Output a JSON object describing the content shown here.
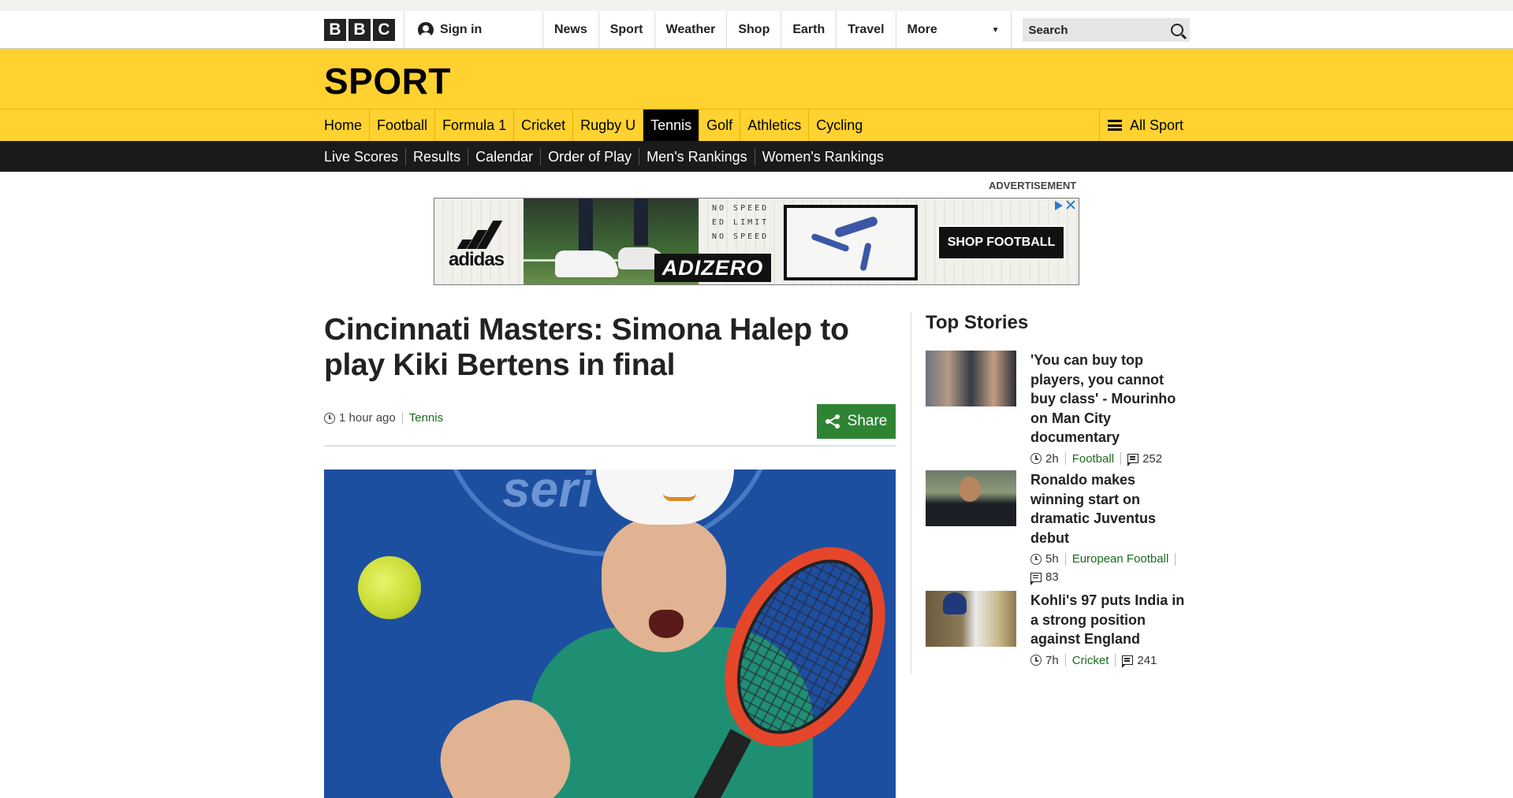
{
  "masthead": {
    "logo_letters": [
      "B",
      "B",
      "C"
    ],
    "signin": "Sign in",
    "nav": [
      "News",
      "Sport",
      "Weather",
      "Shop",
      "Earth",
      "Travel"
    ],
    "more": "More",
    "search_placeholder": "Search"
  },
  "sport": {
    "title": "SPORT",
    "nav": [
      "Home",
      "Football",
      "Formula 1",
      "Cricket",
      "Rugby U",
      "Tennis",
      "Golf",
      "Athletics",
      "Cycling"
    ],
    "active": "Tennis",
    "all_sport": "All Sport",
    "subnav": [
      "Live Scores",
      "Results",
      "Calendar",
      "Order of Play",
      "Men's Rankings",
      "Women's Rankings"
    ]
  },
  "ad": {
    "label": "ADVERTISEMENT",
    "brand": "adidas",
    "product": "ADIZERO",
    "cta": "SHOP FOOTBALL",
    "speed_text": [
      "NO SPEED",
      "ED LIMIT",
      "NO SPEED"
    ]
  },
  "article": {
    "headline": "Cincinnati Masters: Simona Halep to play Kiki Bertens in final",
    "time": "1 hour ago",
    "section": "Tennis",
    "share": "Share"
  },
  "top_stories": {
    "title": "Top Stories",
    "items": [
      {
        "title": "'You can buy top players, you cannot buy class' - Mourinho on Man City documentary",
        "time": "2h",
        "section": "Football",
        "comments": "252"
      },
      {
        "title": "Ronaldo makes winning start on dramatic Juventus debut",
        "time": "5h",
        "section": "European Football",
        "comments": "83"
      },
      {
        "title": "Kohli's 97 puts India in a strong position against England",
        "time": "7h",
        "section": "Cricket",
        "comments": "241"
      }
    ]
  },
  "colors": {
    "sport_yellow": "#ffd230",
    "subnav_black": "#1a1a1a",
    "share_green": "#2f8434",
    "link_green": "#1c6b1c"
  }
}
